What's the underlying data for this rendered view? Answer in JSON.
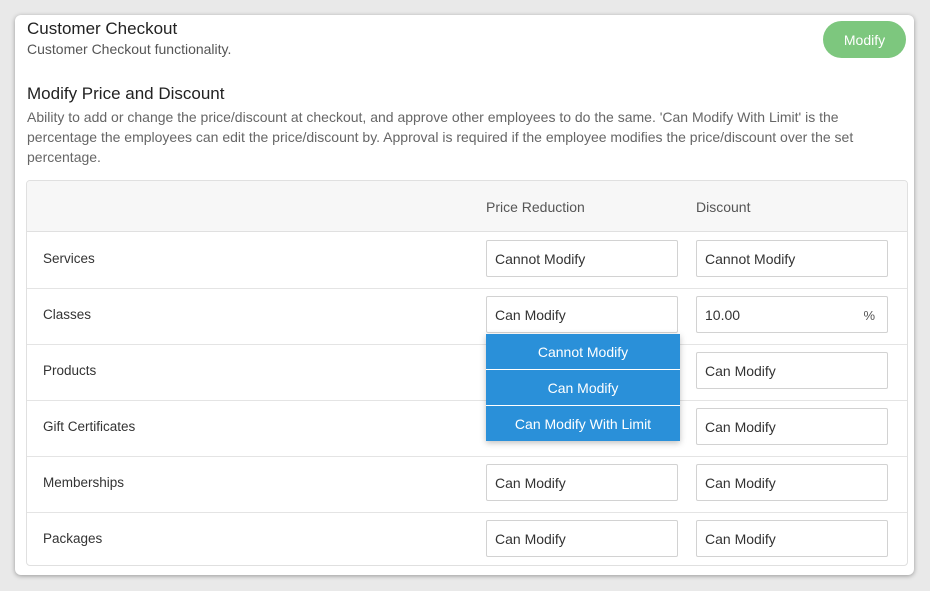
{
  "header": {
    "title": "Customer Checkout",
    "subtitle": "Customer Checkout functionality.",
    "modify_label": "Modify"
  },
  "section": {
    "title": "Modify Price and Discount",
    "description": "Ability to add or change the price/discount at checkout, and approve other employees to do the same. 'Can Modify With Limit' is the percentage the employees can edit the price/discount by. Approval is required if the employee modifies the price/discount over the set percentage."
  },
  "table": {
    "columns": [
      "",
      "Price Reduction",
      "Discount"
    ],
    "rows": [
      {
        "label": "Services",
        "price_reduction": "Cannot Modify",
        "discount": "Cannot Modify"
      },
      {
        "label": "Classes",
        "price_reduction": "Can Modify",
        "discount": "10.00",
        "discount_unit": "%"
      },
      {
        "label": "Products",
        "price_reduction": "",
        "discount": "Can Modify"
      },
      {
        "label": "Gift Certificates",
        "price_reduction": "",
        "discount": "Can Modify"
      },
      {
        "label": "Memberships",
        "price_reduction": "Can Modify",
        "discount": "Can Modify"
      },
      {
        "label": "Packages",
        "price_reduction": "Can Modify",
        "discount": "Can Modify"
      }
    ]
  },
  "dropdown": {
    "options": [
      "Cannot Modify",
      "Can Modify",
      "Can Modify With Limit"
    ]
  },
  "colors": {
    "modify_button": "#7dc77e",
    "dropdown_bg": "#2a90d9"
  }
}
